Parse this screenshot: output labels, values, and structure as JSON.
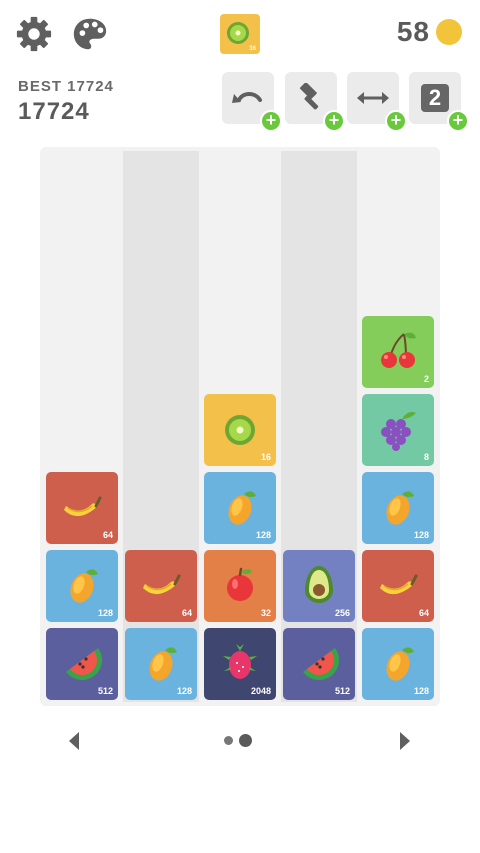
{
  "next_tile": {
    "value": "16",
    "color": "#f3c04a",
    "fruit": "kiwi-icon"
  },
  "coins": "58",
  "best_label": "BEST 17724",
  "score": "17724",
  "tools": [
    {
      "name": "undo-icon"
    },
    {
      "name": "hammer-icon"
    },
    {
      "name": "swap-icon"
    },
    {
      "name": "two-icon",
      "label": "2"
    }
  ],
  "board": {
    "columns": 5,
    "tiles": [
      {
        "col": 0,
        "row": 0,
        "value": "512",
        "fruit": "watermelon",
        "color": "#5b5f9e"
      },
      {
        "col": 0,
        "row": 1,
        "value": "128",
        "fruit": "mango",
        "color": "#6ab3de"
      },
      {
        "col": 0,
        "row": 2,
        "value": "64",
        "fruit": "banana",
        "color": "#cf5f4d"
      },
      {
        "col": 1,
        "row": 0,
        "value": "128",
        "fruit": "mango",
        "color": "#6ab3de"
      },
      {
        "col": 1,
        "row": 1,
        "value": "64",
        "fruit": "banana",
        "color": "#cf5f4d"
      },
      {
        "col": 2,
        "row": 0,
        "value": "2048",
        "fruit": "dragonfruit",
        "color": "#3f4770"
      },
      {
        "col": 2,
        "row": 1,
        "value": "32",
        "fruit": "apple",
        "color": "#e28047"
      },
      {
        "col": 2,
        "row": 2,
        "value": "128",
        "fruit": "mango",
        "color": "#6ab3de"
      },
      {
        "col": 2,
        "row": 3,
        "value": "16",
        "fruit": "kiwi",
        "color": "#f3c04a"
      },
      {
        "col": 3,
        "row": 0,
        "value": "512",
        "fruit": "watermelon",
        "color": "#5b5f9e"
      },
      {
        "col": 3,
        "row": 1,
        "value": "256",
        "fruit": "avocado",
        "color": "#7381c2"
      },
      {
        "col": 4,
        "row": 0,
        "value": "128",
        "fruit": "mango",
        "color": "#6ab3de"
      },
      {
        "col": 4,
        "row": 1,
        "value": "64",
        "fruit": "banana",
        "color": "#cf5f4d"
      },
      {
        "col": 4,
        "row": 2,
        "value": "128",
        "fruit": "mango",
        "color": "#6ab3de"
      },
      {
        "col": 4,
        "row": 3,
        "value": "8",
        "fruit": "grapes",
        "color": "#73c9a3"
      },
      {
        "col": 4,
        "row": 4,
        "value": "2",
        "fruit": "cherry",
        "color": "#84cd5a"
      }
    ]
  },
  "pagination": {
    "count": 2,
    "active": 1
  }
}
